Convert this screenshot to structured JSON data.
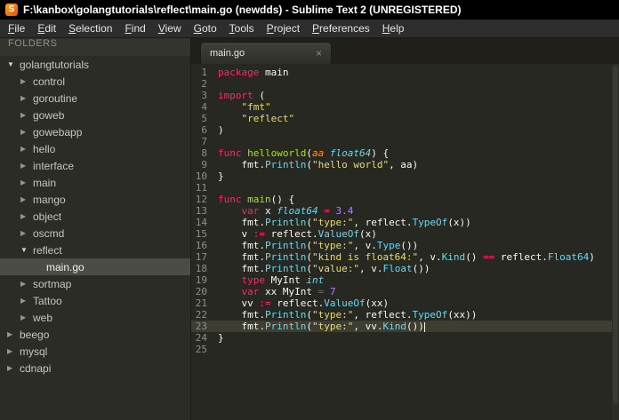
{
  "window": {
    "title": "F:\\kanbox\\golangtutorials\\reflect\\main.go (newdds) - Sublime Text 2 (UNREGISTERED)",
    "app_icon": "S"
  },
  "menu": {
    "items": [
      "File",
      "Edit",
      "Selection",
      "Find",
      "View",
      "Goto",
      "Tools",
      "Project",
      "Preferences",
      "Help"
    ]
  },
  "sidebar": {
    "header": "FOLDERS",
    "items": [
      {
        "label": "golangtutorials",
        "depth": 0,
        "kind": "folder",
        "expanded": true,
        "selected": false
      },
      {
        "label": "control",
        "depth": 1,
        "kind": "folder",
        "expanded": false,
        "selected": false
      },
      {
        "label": "goroutine",
        "depth": 1,
        "kind": "folder",
        "expanded": false,
        "selected": false
      },
      {
        "label": "goweb",
        "depth": 1,
        "kind": "folder",
        "expanded": false,
        "selected": false
      },
      {
        "label": "gowebapp",
        "depth": 1,
        "kind": "folder",
        "expanded": false,
        "selected": false
      },
      {
        "label": "hello",
        "depth": 1,
        "kind": "folder",
        "expanded": false,
        "selected": false
      },
      {
        "label": "interface",
        "depth": 1,
        "kind": "folder",
        "expanded": false,
        "selected": false
      },
      {
        "label": "main",
        "depth": 1,
        "kind": "folder",
        "expanded": false,
        "selected": false
      },
      {
        "label": "mango",
        "depth": 1,
        "kind": "folder",
        "expanded": false,
        "selected": false
      },
      {
        "label": "object",
        "depth": 1,
        "kind": "folder",
        "expanded": false,
        "selected": false
      },
      {
        "label": "oscmd",
        "depth": 1,
        "kind": "folder",
        "expanded": false,
        "selected": false
      },
      {
        "label": "reflect",
        "depth": 1,
        "kind": "folder",
        "expanded": true,
        "selected": false
      },
      {
        "label": "main.go",
        "depth": 2,
        "kind": "file",
        "expanded": false,
        "selected": true
      },
      {
        "label": "sortmap",
        "depth": 1,
        "kind": "folder",
        "expanded": false,
        "selected": false
      },
      {
        "label": "Tattoo",
        "depth": 1,
        "kind": "folder",
        "expanded": false,
        "selected": false
      },
      {
        "label": "web",
        "depth": 1,
        "kind": "folder",
        "expanded": false,
        "selected": false
      },
      {
        "label": "beego",
        "depth": 0,
        "kind": "folder",
        "expanded": false,
        "selected": false
      },
      {
        "label": "mysql",
        "depth": 0,
        "kind": "folder",
        "expanded": false,
        "selected": false
      },
      {
        "label": "cdnapi",
        "depth": 0,
        "kind": "folder",
        "expanded": false,
        "selected": false
      }
    ]
  },
  "tab": {
    "label": "main.go",
    "close_glyph": "×"
  },
  "editor": {
    "language": "Go",
    "active_line": 23,
    "lines": [
      {
        "n": 1,
        "segs": [
          [
            "kw",
            "package"
          ],
          [
            "pl",
            " main"
          ]
        ]
      },
      {
        "n": 2,
        "segs": []
      },
      {
        "n": 3,
        "segs": [
          [
            "kw",
            "import"
          ],
          [
            "pl",
            " ("
          ]
        ]
      },
      {
        "n": 4,
        "segs": [
          [
            "pl",
            "    "
          ],
          [
            "str",
            "\"fmt\""
          ]
        ]
      },
      {
        "n": 5,
        "segs": [
          [
            "pl",
            "    "
          ],
          [
            "str",
            "\"reflect\""
          ]
        ]
      },
      {
        "n": 6,
        "segs": [
          [
            "pl",
            ")"
          ]
        ]
      },
      {
        "n": 7,
        "segs": []
      },
      {
        "n": 8,
        "segs": [
          [
            "kw",
            "func"
          ],
          [
            "pl",
            " "
          ],
          [
            "fn",
            "helloworld"
          ],
          [
            "pl",
            "("
          ],
          [
            "par",
            "aa"
          ],
          [
            "pl",
            " "
          ],
          [
            "ty",
            "float64"
          ],
          [
            "pl",
            ") {"
          ]
        ]
      },
      {
        "n": 9,
        "segs": [
          [
            "pl",
            "    fmt."
          ],
          [
            "call",
            "Println"
          ],
          [
            "pl",
            "("
          ],
          [
            "str",
            "\"hello world\""
          ],
          [
            "pl",
            ", aa)"
          ]
        ]
      },
      {
        "n": 10,
        "segs": [
          [
            "pl",
            "}"
          ]
        ]
      },
      {
        "n": 11,
        "segs": []
      },
      {
        "n": 12,
        "segs": [
          [
            "kw",
            "func"
          ],
          [
            "pl",
            " "
          ],
          [
            "fn",
            "main"
          ],
          [
            "pl",
            "() {"
          ]
        ]
      },
      {
        "n": 13,
        "segs": [
          [
            "pl",
            "    "
          ],
          [
            "kw",
            "var"
          ],
          [
            "pl",
            " x "
          ],
          [
            "ty",
            "float64"
          ],
          [
            "pl",
            " "
          ],
          [
            "op",
            "="
          ],
          [
            "pl",
            " "
          ],
          [
            "num",
            "3.4"
          ]
        ]
      },
      {
        "n": 14,
        "segs": [
          [
            "pl",
            "    fmt."
          ],
          [
            "call",
            "Println"
          ],
          [
            "pl",
            "("
          ],
          [
            "str",
            "\"type:\""
          ],
          [
            "pl",
            ", reflect."
          ],
          [
            "call",
            "TypeOf"
          ],
          [
            "pl",
            "(x))"
          ]
        ]
      },
      {
        "n": 15,
        "segs": [
          [
            "pl",
            "    v "
          ],
          [
            "op",
            ":="
          ],
          [
            "pl",
            " reflect."
          ],
          [
            "call",
            "ValueOf"
          ],
          [
            "pl",
            "(x)"
          ]
        ]
      },
      {
        "n": 16,
        "segs": [
          [
            "pl",
            "    fmt."
          ],
          [
            "call",
            "Println"
          ],
          [
            "pl",
            "("
          ],
          [
            "str",
            "\"type:\""
          ],
          [
            "pl",
            ", v."
          ],
          [
            "call",
            "Type"
          ],
          [
            "pl",
            "())"
          ]
        ]
      },
      {
        "n": 17,
        "segs": [
          [
            "pl",
            "    fmt."
          ],
          [
            "call",
            "Println"
          ],
          [
            "pl",
            "("
          ],
          [
            "str",
            "\"kind is float64:\""
          ],
          [
            "pl",
            ", v."
          ],
          [
            "call",
            "Kind"
          ],
          [
            "pl",
            "() "
          ],
          [
            "op",
            "=="
          ],
          [
            "pl",
            " reflect."
          ],
          [
            "call",
            "Float64"
          ],
          [
            "pl",
            ")"
          ]
        ]
      },
      {
        "n": 18,
        "segs": [
          [
            "pl",
            "    fmt."
          ],
          [
            "call",
            "Println"
          ],
          [
            "pl",
            "("
          ],
          [
            "str",
            "\"value:\""
          ],
          [
            "pl",
            ", v."
          ],
          [
            "call",
            "Float"
          ],
          [
            "pl",
            "())"
          ]
        ]
      },
      {
        "n": 19,
        "segs": [
          [
            "pl",
            "    "
          ],
          [
            "kw",
            "type"
          ],
          [
            "pl",
            " MyInt "
          ],
          [
            "ty",
            "int"
          ]
        ]
      },
      {
        "n": 20,
        "segs": [
          [
            "pl",
            "    "
          ],
          [
            "kw",
            "var"
          ],
          [
            "pl",
            " xx MyInt "
          ],
          [
            "op",
            "="
          ],
          [
            "pl",
            " "
          ],
          [
            "num",
            "7"
          ]
        ]
      },
      {
        "n": 21,
        "segs": [
          [
            "pl",
            "    vv "
          ],
          [
            "op",
            ":="
          ],
          [
            "pl",
            " reflect."
          ],
          [
            "call",
            "ValueOf"
          ],
          [
            "pl",
            "(xx)"
          ]
        ]
      },
      {
        "n": 22,
        "segs": [
          [
            "pl",
            "    fmt."
          ],
          [
            "call",
            "Println"
          ],
          [
            "pl",
            "("
          ],
          [
            "str",
            "\"type:\""
          ],
          [
            "pl",
            ", reflect."
          ],
          [
            "call",
            "TypeOf"
          ],
          [
            "pl",
            "(xx))"
          ]
        ]
      },
      {
        "n": 23,
        "segs": [
          [
            "pl",
            "    fmt."
          ],
          [
            "call",
            "Println"
          ],
          [
            "pl",
            "("
          ],
          [
            "str",
            "\"type:\""
          ],
          [
            "pl",
            ", vv."
          ],
          [
            "call",
            "Kind"
          ],
          [
            "pl",
            "())"
          ]
        ],
        "cursor": true
      },
      {
        "n": 24,
        "segs": [
          [
            "pl",
            "}"
          ]
        ]
      },
      {
        "n": 25,
        "segs": []
      }
    ]
  },
  "colors": {
    "editor-bg": "#272822",
    "text": "#f8f8f2",
    "gutter": "#8f908a",
    "line-highlight": "#3e3d32",
    "kw": "#f92672",
    "str": "#e6db74",
    "num": "#ae81ff",
    "ty": "#66d9ef",
    "fn": "#a6e22e",
    "call": "#66d9ef",
    "op": "#f92672",
    "par": "#fd971f",
    "sidebar-bg": "#2c2c27",
    "sidebar-selected": "#4c4c46",
    "titlebar-bg": "#000000",
    "menubar-bg": "#2d2d2d",
    "tabbar-bg": "#201f1b"
  }
}
